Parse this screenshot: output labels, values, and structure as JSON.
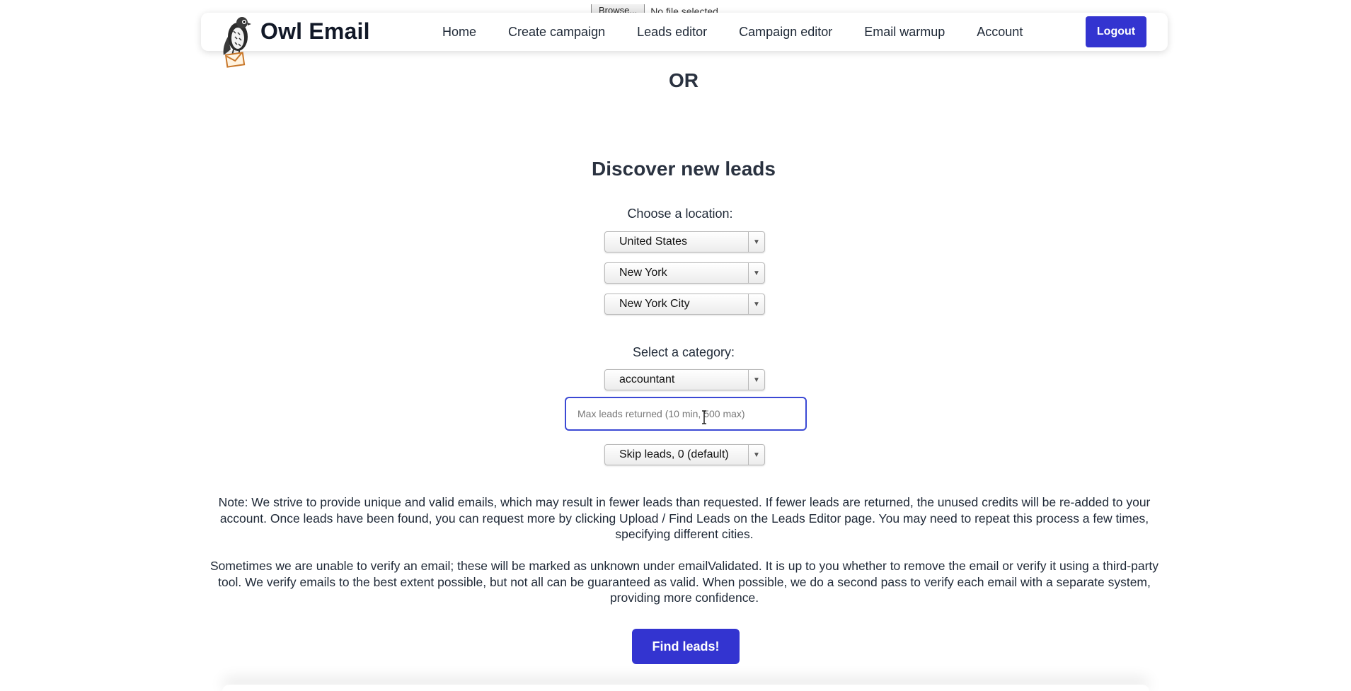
{
  "file_input": {
    "browse_label": "Browse...",
    "status": "No file selected."
  },
  "header": {
    "brand": "Owl Email",
    "nav": [
      "Home",
      "Create campaign",
      "Leads editor",
      "Campaign editor",
      "Email warmup",
      "Account"
    ],
    "logout_label": "Logout",
    "logo_icon": "owl-envelope-logo"
  },
  "or_text": "OR",
  "discover": {
    "title": "Discover new leads",
    "location_label": "Choose a location:",
    "country": "United States",
    "state": "New York",
    "city": "New York City",
    "category_label": "Select a category:",
    "category": "accountant",
    "max_leads_placeholder": "Max leads returned (10 min, 500 max)",
    "skip_leads": "Skip leads, 0 (default)",
    "note_1": "Note: We strive to provide unique and valid emails, which may result in fewer leads than requested. If fewer leads are returned, the unused credits will be re-added to your account. Once leads have been found, you can request more by clicking Upload / Find Leads on the Leads Editor page. You may need to repeat this process a few times, specifying different cities.",
    "note_2": "Sometimes we are unable to verify an email; these will be marked as unknown under emailValidated. It is up to you whether to remove the email or verify it using a third-party tool. We verify emails to the best extent possible, but not all can be guaranteed as valid. When possible, we do a second pass to verify each email with a separate system, providing more confidence.",
    "find_button": "Find leads!"
  },
  "colors": {
    "primary": "#3334d0",
    "text": "#1f2937",
    "focus_border": "#3b49d4"
  }
}
